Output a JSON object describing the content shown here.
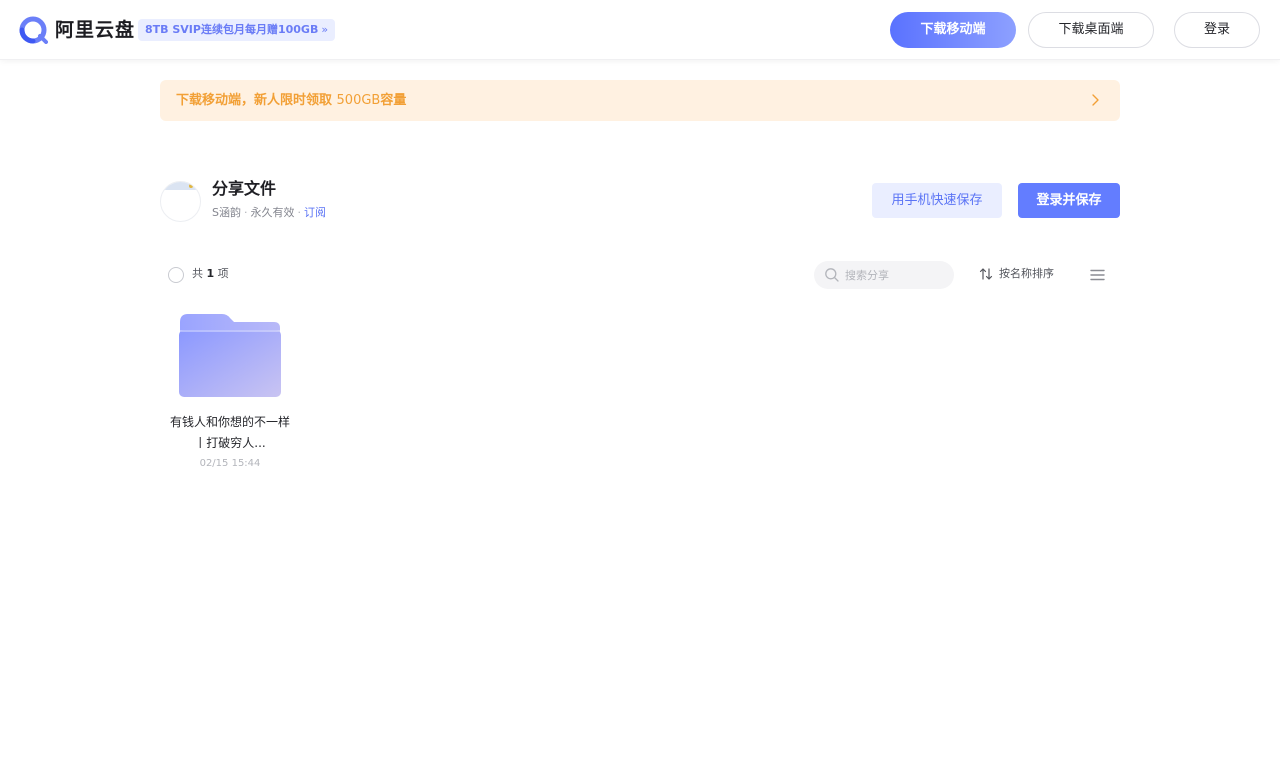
{
  "header": {
    "brand": "阿里云盘",
    "promo": "8TB SVIP连续包月每月赠100GB",
    "promo_chevron": "»",
    "download_mobile": "下载移动端",
    "download_desktop": "下载桌面端",
    "login": "登录"
  },
  "banner": {
    "text_bold": "下载移动端，新人限时领取 ",
    "text_normal": "500GB",
    "text_tail": "容量"
  },
  "share": {
    "title": "分享文件",
    "owner": "S涵韵",
    "validity": "永久有效",
    "subscribe": "订阅",
    "separator": "·",
    "phone_save": "用手机快速保存",
    "login_save": "登录并保存"
  },
  "toolbar": {
    "count_prefix": "共 ",
    "count_value": "1",
    "count_suffix": " 项",
    "search_placeholder": "搜索分享",
    "sort_label": "按名称排序"
  },
  "files": [
    {
      "name": "有钱人和你想的不一样丨打破穷人...",
      "date": "02/15 15:44"
    }
  ],
  "colors": {
    "accent": "#637dff",
    "banner_bg": "#fff1e1",
    "banner_text": "#f2a036"
  }
}
